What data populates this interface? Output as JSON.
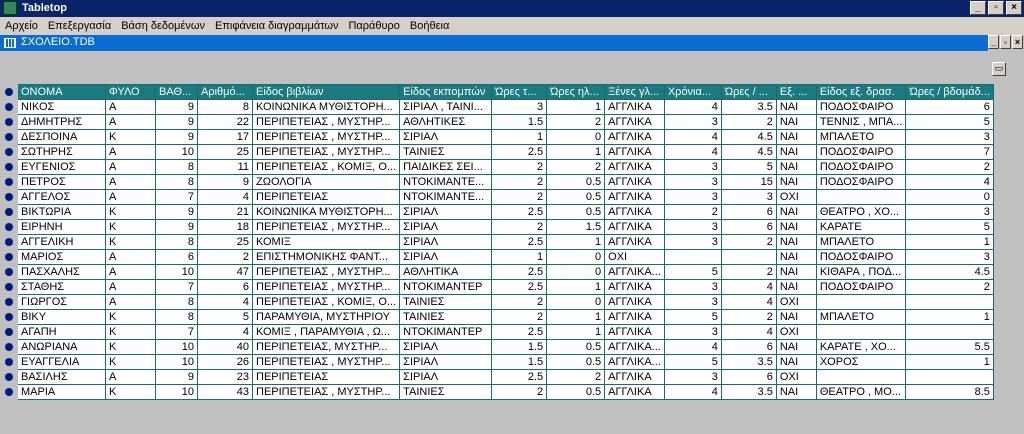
{
  "app": {
    "title": "Tabletop"
  },
  "window_buttons": {
    "minimize": "_",
    "restore": "▫",
    "close": "×"
  },
  "menu": [
    "Αρχείο",
    "Επεξεργασία",
    "Βάση δεδομένων",
    "Επιφάνεια διαγραμμάτων",
    "Παράθυρο",
    "Βοήθεια"
  ],
  "document": {
    "title": "ΣΧΟΛΕΙΟ.TDB"
  },
  "table": {
    "columns": [
      "ΟΝΟΜΑ",
      "ΦΥΛΟ",
      "ΒΑΘ...",
      "Αριθμό...",
      "Είδος βιβλίων",
      "Είδος εκπομπών",
      "Ώρες τ...",
      "Ώρες ηλ...",
      "Ξένες γλ...",
      "Χρόνια...",
      "Ώρες / ...",
      "Εξ. ...",
      "Είδος εξ. δρασ.",
      "Ώρες / βδομάδ..."
    ],
    "rows": [
      [
        "ΝΙΚΟΣ",
        "Α",
        "9",
        "8",
        "ΚΟΙΝΩΝΙΚΑ ΜΥΘΙΣΤΟΡΗ...",
        "ΣΙΡΙΑΛ , ΤΑΙΝΙ...",
        "3",
        "1",
        "ΑΓΓΛΙΚΑ",
        "4",
        "3.5",
        "ΝΑΙ",
        "ΠΟΔΟΣΦΑΙΡΟ",
        "6"
      ],
      [
        "ΔΗΜΗΤΡΗΣ",
        "Α",
        "9",
        "22",
        "ΠΕΡΙΠΕΤΕΙΑΣ , ΜΥΣΤΗΡ...",
        "ΑΘΛΗΤΙΚΕΣ",
        "1.5",
        "2",
        "ΑΓΓΛΙΚΑ",
        "3",
        "2",
        "ΝΑΙ",
        "ΤΕΝΝΙΣ , ΜΠΑ...",
        "5"
      ],
      [
        "ΔΕΣΠΟΙΝΑ",
        "Κ",
        "9",
        "17",
        "ΠΕΡΙΠΕΤΕΙΑΣ , ΜΥΣΤΗΡ...",
        "ΣΙΡΙΑΛ",
        "1",
        "0",
        "ΑΓΓΛΙΚΑ",
        "4",
        "4.5",
        "ΝΑΙ",
        "ΜΠΑΛΕΤΟ",
        "3"
      ],
      [
        "ΣΩΤΗΡΗΣ",
        "Α",
        "10",
        "25",
        "ΠΕΡΙΠΕΤΕΙΑΣ , ΜΥΣΤΗΡ...",
        "ΤΑΙΝΙΕΣ",
        "2.5",
        "1",
        "ΑΓΓΛΙΚΑ",
        "4",
        "4.5",
        "ΝΑΙ",
        "ΠΟΔΟΣΦΑΙΡΟ",
        "7"
      ],
      [
        "ΕΥΓΕΝΙΟΣ",
        "Α",
        "8",
        "11",
        "ΠΕΡΙΠΕΤΕΙΑΣ , ΚΟΜΙΞ, Ο...",
        "ΠΑΙΔΙΚΕΣ ΣΕΙ...",
        "2",
        "2",
        "ΑΓΓΛΙΚΑ",
        "3",
        "5",
        "ΝΑΙ",
        "ΠΟΔΟΣΦΑΙΡΟ",
        "2"
      ],
      [
        "ΠΕΤΡΟΣ",
        "Α",
        "8",
        "9",
        "ΖΩΟΛΟΓΙΑ",
        "ΝΤΟΚΙΜΑΝΤΕ...",
        "2",
        "0.5",
        "ΑΓΓΛΙΚΑ",
        "3",
        "15",
        "ΝΑΙ",
        "ΠΟΔΟΣΦΑΙΡΟ",
        "4"
      ],
      [
        "ΑΓΓΕΛΟΣ",
        "Α",
        "7",
        "4",
        "ΠΕΡΙΠΕΤΕΙΑΣ",
        "ΝΤΟΚΙΜΑΝΤΕ...",
        "2",
        "0.5",
        "ΑΓΓΛΙΚΑ",
        "3",
        "3",
        "ΟΧΙ",
        "",
        "0"
      ],
      [
        "ΒΙΚΤΩΡΙΑ",
        "Κ",
        "9",
        "21",
        "ΚΟΙΝΩΝΙΚΑ ΜΥΘΙΣΤΟΡΗ...",
        "ΣΙΡΙΑΛ",
        "2.5",
        "0.5",
        "ΑΓΓΛΙΚΑ",
        "2",
        "6",
        "ΝΑΙ",
        "ΘΕΑΤΡΟ , ΧΟ...",
        "3"
      ],
      [
        "ΕΙΡΗΝΗ",
        "Κ",
        "9",
        "18",
        "ΠΕΡΙΠΕΤΕΙΑΣ , ΜΥΣΤΗΡ...",
        "ΣΙΡΙΑΛ",
        "2",
        "1.5",
        "ΑΓΓΛΙΚΑ",
        "3",
        "6",
        "ΝΑΙ",
        "ΚΑΡΑΤΕ",
        "5"
      ],
      [
        "ΑΓΓΕΛΙΚΗ",
        "Κ",
        "8",
        "25",
        "ΚΟΜΙΞ",
        "ΣΙΡΙΑΛ",
        "2.5",
        "1",
        "ΑΓΓΛΙΚΑ",
        "3",
        "2",
        "ΝΑΙ",
        "ΜΠΑΛΕΤΟ",
        "1"
      ],
      [
        "ΜΑΡΙΟΣ",
        "Α",
        "6",
        "2",
        "ΕΠΙΣΤΗΜΟΝΙΚΗΣ ΦΑΝΤ...",
        "ΣΙΡΙΑΛ",
        "1",
        "0",
        "ΟΧΙ",
        "",
        "",
        "ΝΑΙ",
        "ΠΟΔΟΣΦΑΙΡΟ",
        "3"
      ],
      [
        "ΠΑΣΧΑΛΗΣ",
        "Α",
        "10",
        "47",
        "ΠΕΡΙΠΕΤΕΙΑΣ , ΜΥΣΤΗΡ...",
        "ΑΘΛΗΤΙΚΑ",
        "2.5",
        "0",
        "ΑΓΓΛΙΚΑ...",
        "5",
        "2",
        "ΝΑΙ",
        "ΚΙΘΑΡΑ , ΠΟΔ...",
        "4.5"
      ],
      [
        "ΣΤΑΘΗΣ",
        "Α",
        "7",
        "6",
        "ΠΕΡΙΠΕΤΕΙΑΣ , ΜΥΣΤΗΡ...",
        "ΝΤΟΚΙΜΑΝΤΕΡ",
        "2.5",
        "1",
        "ΑΓΓΛΙΚΑ",
        "3",
        "4",
        "ΝΑΙ",
        "ΠΟΔΟΣΦΑΙΡΟ",
        "2"
      ],
      [
        "ΓΙΩΡΓΟΣ",
        "Α",
        "8",
        "4",
        "ΠΕΡΙΠΕΤΕΙΑΣ , ΚΟΜΙΞ, Ο...",
        "ΤΑΙΝΙΕΣ",
        "2",
        "0",
        "ΑΓΓΛΙΚΑ",
        "3",
        "4",
        "ΟΧΙ",
        "",
        ""
      ],
      [
        "ΒΙΚΥ",
        "Κ",
        "8",
        "5",
        "ΠΑΡΑΜΥΘΙΑ, ΜΥΣΤΗΡΙΟΥ",
        "ΤΑΙΝΙΕΣ",
        "2",
        "1",
        "ΑΓΓΛΙΚΑ",
        "5",
        "2",
        "ΝΑΙ",
        "ΜΠΑΛΕΤΟ",
        "1"
      ],
      [
        "ΑΓΑΠΗ",
        "Κ",
        "7",
        "4",
        "ΚΟΜΙΞ , ΠΑΡΑΜΥΘΙΑ , Ω...",
        "ΝΤΟΚΙΜΑΝΤΕΡ",
        "2.5",
        "1",
        "ΑΓΓΛΙΚΑ",
        "3",
        "4",
        "ΟΧΙ",
        "",
        ""
      ],
      [
        "ΑΝΩΡΙΑΝΑ",
        "Κ",
        "10",
        "40",
        "ΠΕΡΙΠΕΤΕΙΑΣ, ΜΥΣΤΗΡ...",
        "ΣΙΡΙΑΛ",
        "1.5",
        "0.5",
        "ΑΓΓΛΙΚΑ...",
        "4",
        "6",
        "ΝΑΙ",
        "ΚΑΡΑΤΕ , ΧΟ...",
        "5.5"
      ],
      [
        "ΕΥΑΓΓΕΛΙΑ",
        "Κ",
        "10",
        "26",
        "ΠΕΡΙΠΕΤΕΙΑΣ , ΜΥΣΤΗΡ...",
        "ΣΙΡΙΑΛ",
        "1.5",
        "0.5",
        "ΑΓΓΛΙΚΑ...",
        "5",
        "3.5",
        "ΝΑΙ",
        "ΧΟΡΟΣ",
        "1"
      ],
      [
        "ΒΑΣΙΛΗΣ",
        "Α",
        "9",
        "23",
        "ΠΕΡΙΠΕΤΕΙΑΣ",
        "ΣΙΡΙΑΛ",
        "2.5",
        "2",
        "ΑΓΓΛΙΚΑ",
        "3",
        "6",
        "ΟΧΙ",
        "",
        ""
      ],
      [
        "ΜΑΡΙΑ",
        "Κ",
        "10",
        "43",
        "ΠΕΡΙΠΕΤΕΙΑΣ , ΜΥΣΤΗΡ...",
        "ΤΑΙΝΙΕΣ",
        "2",
        "0.5",
        "ΑΓΓΛΙΚΑ",
        "4",
        "3.5",
        "ΝΑΙ",
        "ΘΕΑΤΡΟ , ΜΟ...",
        "8.5"
      ]
    ]
  }
}
